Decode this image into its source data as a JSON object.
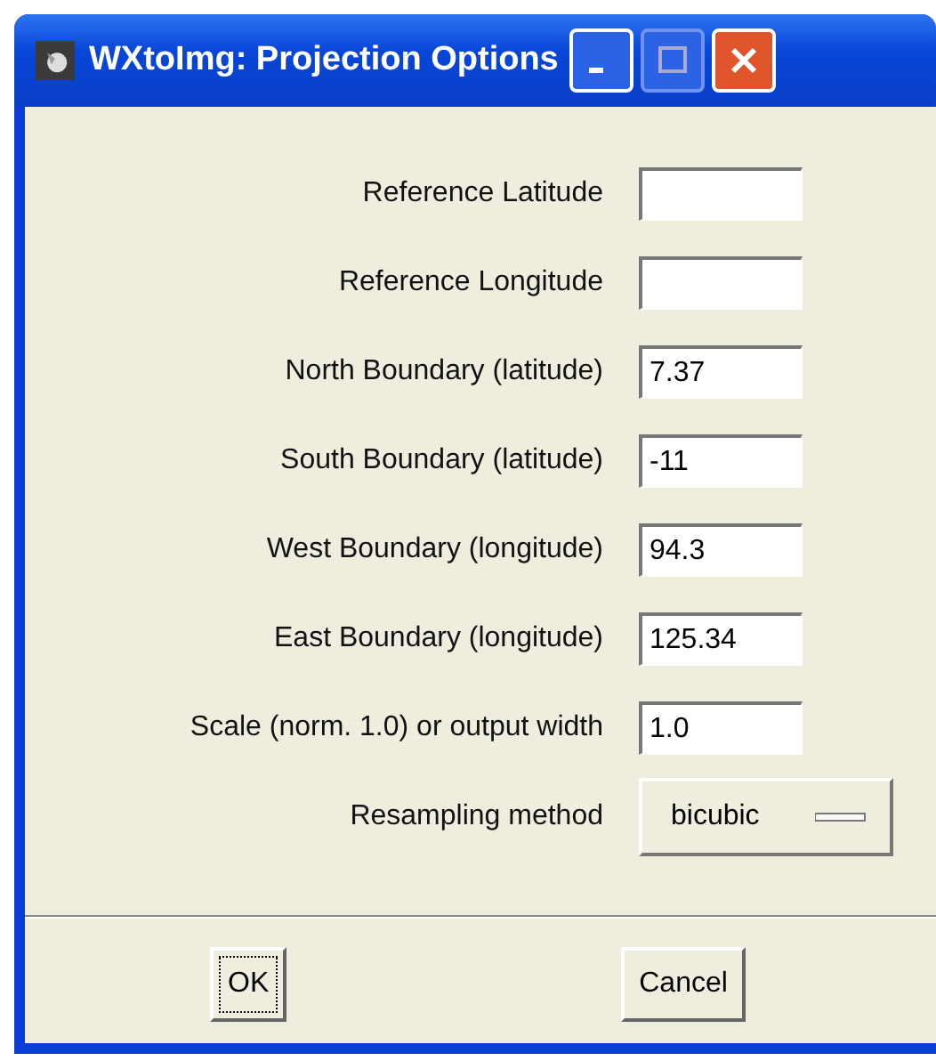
{
  "window": {
    "title": "WXtoImg: Projection Options"
  },
  "fields": [
    {
      "label": "Reference Latitude"
    },
    {
      "label": "Reference Longitude"
    },
    {
      "label": "North Boundary (latitude)",
      "value": "7.37"
    },
    {
      "label": "South Boundary (latitude)",
      "value": "-11"
    },
    {
      "label": "West Boundary (longitude)",
      "value": "94.3"
    },
    {
      "label": "East Boundary (longitude)",
      "value": "125.34"
    },
    {
      "label": "Scale (norm. 1.0) or output width",
      "value": "1.0"
    }
  ],
  "resampling": {
    "label": "Resampling method",
    "value": "bicubic"
  },
  "buttons": [
    "OK",
    "Cancel"
  ]
}
